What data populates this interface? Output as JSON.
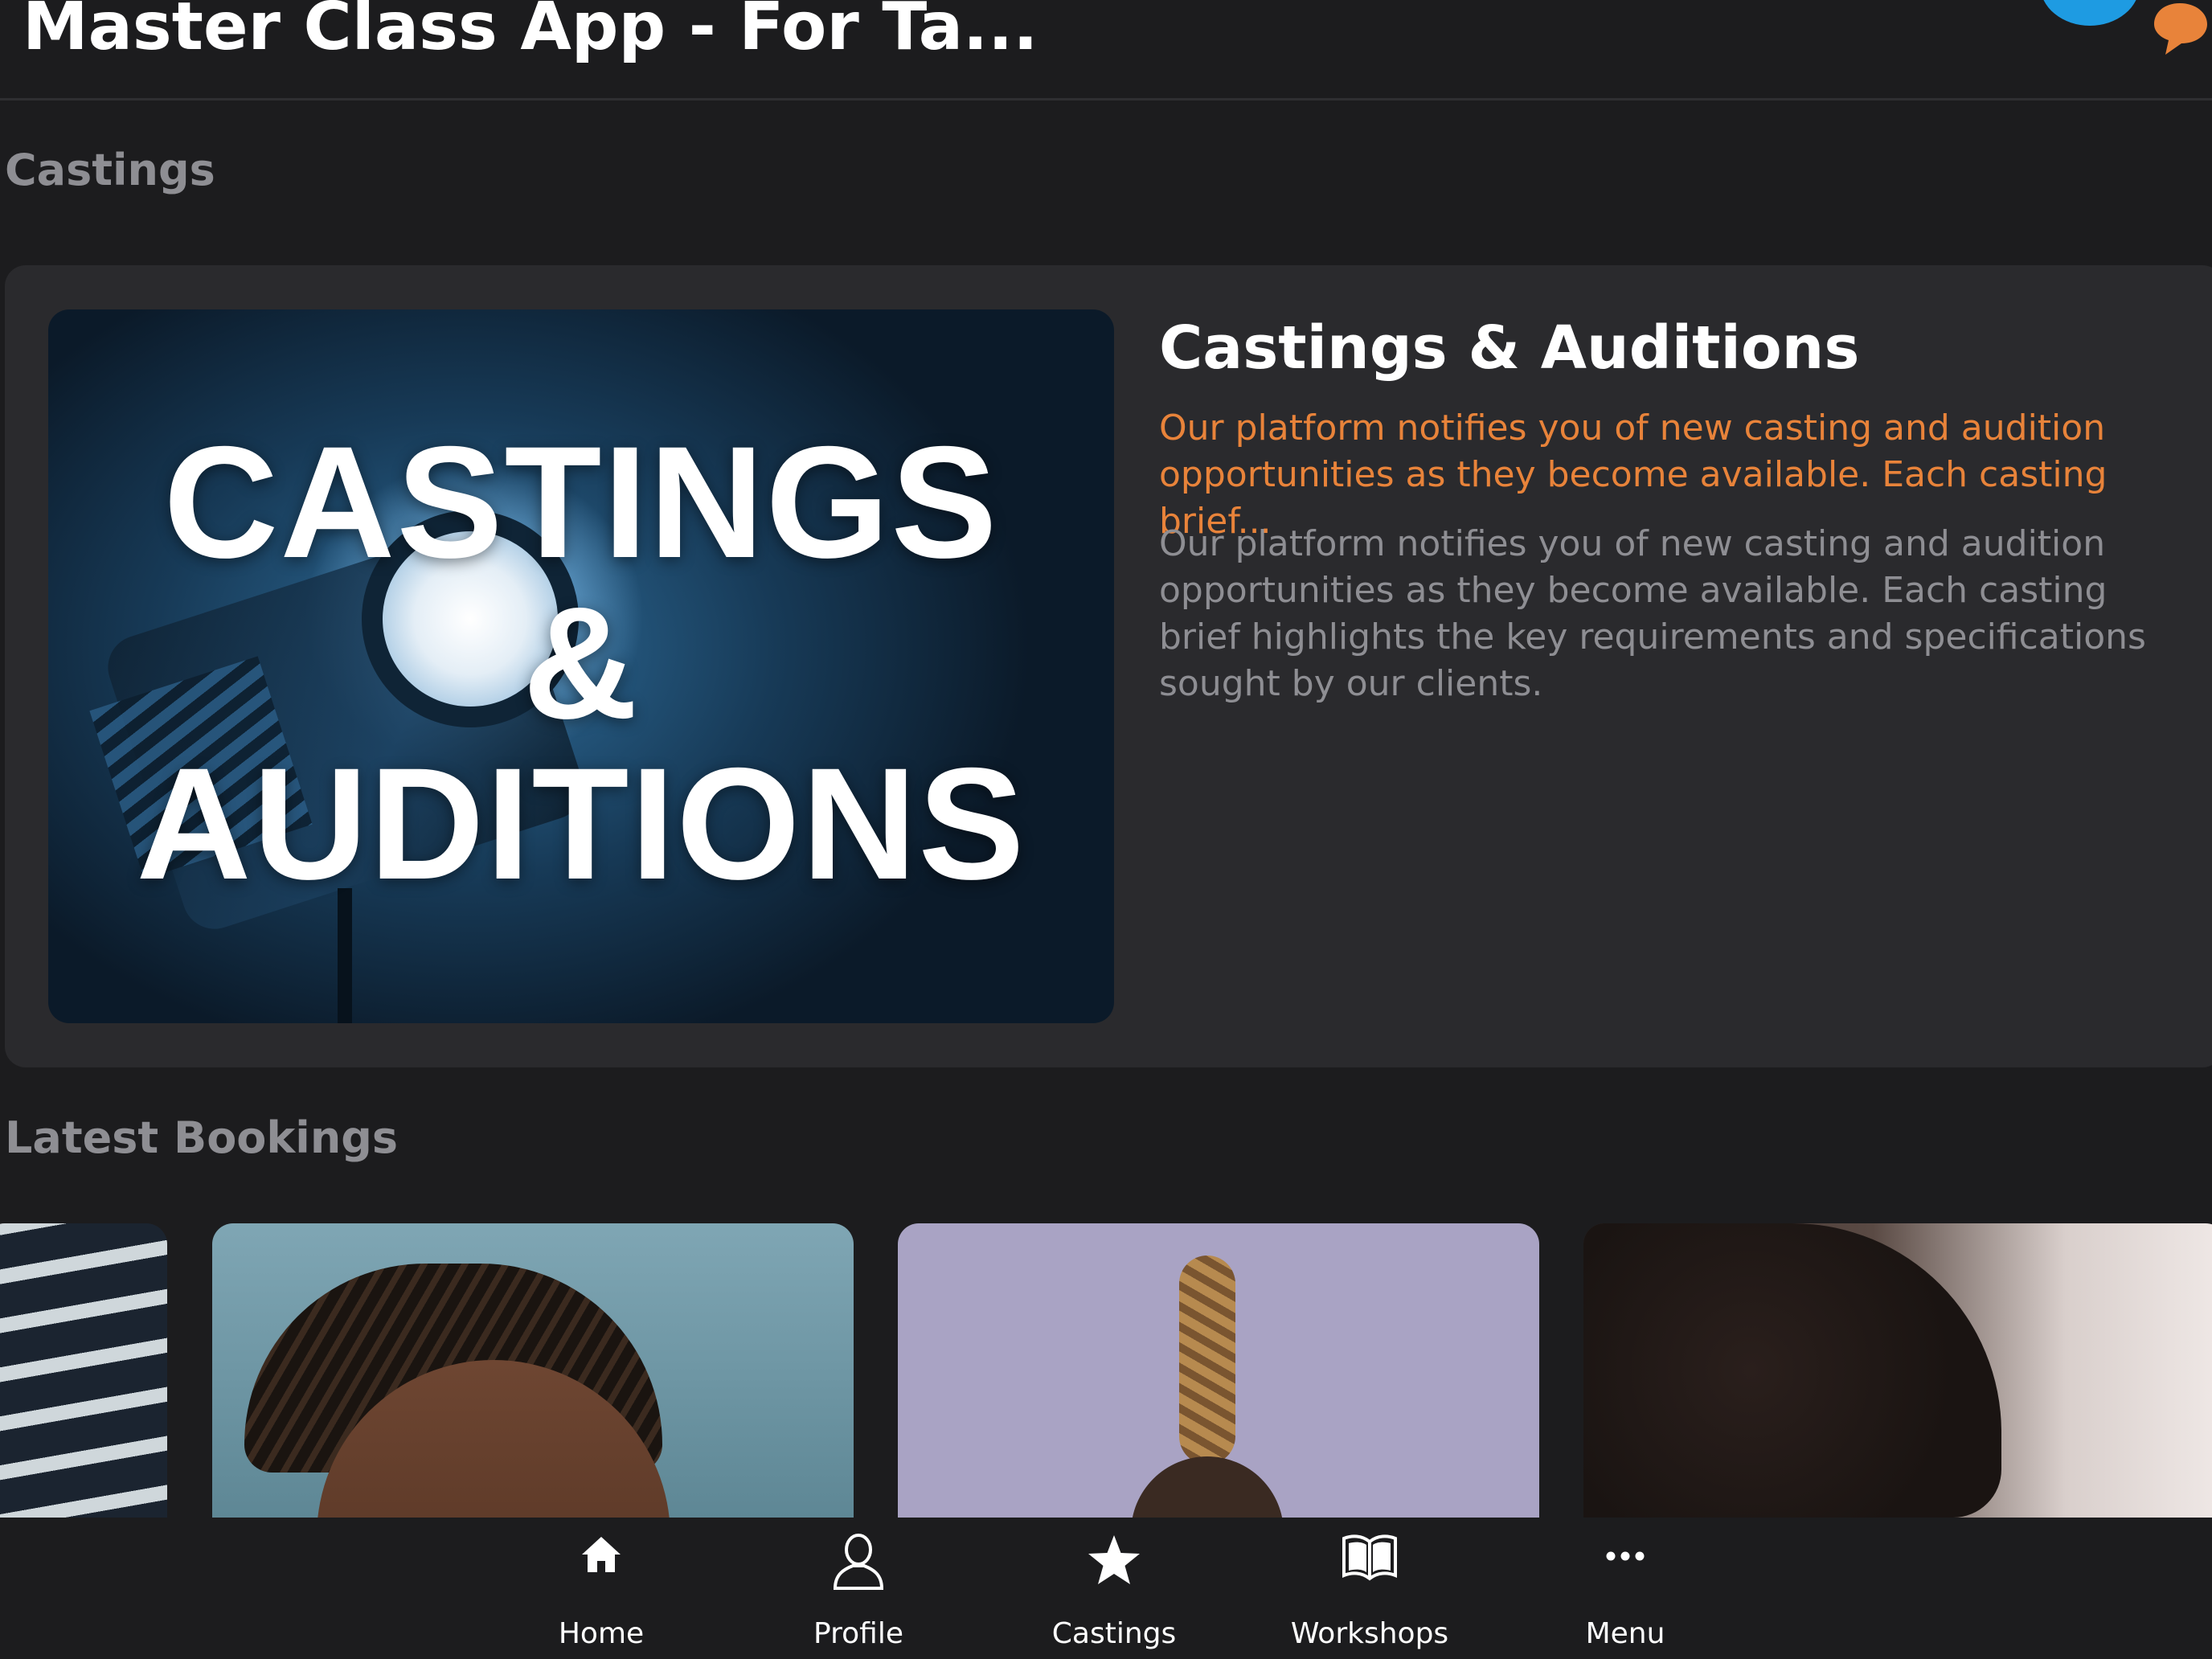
{
  "header": {
    "title": "Master Class App - For Ta..."
  },
  "castings_section": {
    "title": "Castings",
    "card": {
      "image_text": [
        "CASTINGS",
        "&",
        "AUDITIONS"
      ],
      "title": "Castings & Auditions",
      "summary": "Our platform notifies you of new casting and audition opportunities as they become available. Each casting brief...",
      "description": "Our platform notifies you of new casting and audition opportunities as they become available. Each casting brief highlights the key requirements and specifications sought by our clients."
    }
  },
  "bookings_section": {
    "title": "Latest Bookings"
  },
  "tabbar": {
    "items": [
      {
        "label": "Home",
        "icon": "home-icon"
      },
      {
        "label": "Profile",
        "icon": "profile-icon"
      },
      {
        "label": "Castings",
        "icon": "star-icon"
      },
      {
        "label": "Workshops",
        "icon": "book-icon"
      },
      {
        "label": "Menu",
        "icon": "more-icon"
      }
    ]
  },
  "colors": {
    "accent": "#e8833a",
    "background": "#1c1c1e",
    "card": "#2a2a2d",
    "badge": "#1e9be2"
  }
}
